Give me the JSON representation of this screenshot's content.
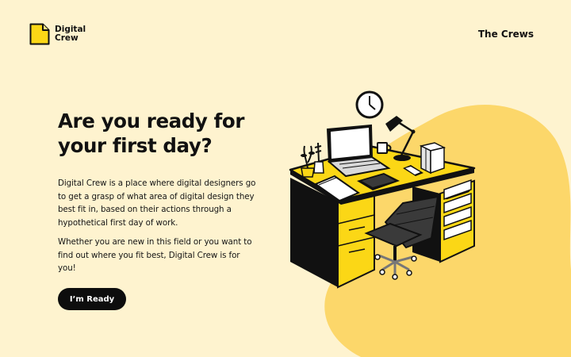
{
  "brand": {
    "name_line1": "Digital",
    "name_line2": "Crew"
  },
  "nav": {
    "crews_link": "The Crews"
  },
  "hero": {
    "title": "Are you ready for your first day?",
    "paragraph_1": "Digital Crew is a place where digital designers go to get a grasp of what area of digital design they best fit in, based on their actions through a hypothetical first day of work.",
    "paragraph_2": "Whether you are new in this field or you want to find out where you fit best, Digital Crew is for you!",
    "cta_label": "I’m Ready"
  },
  "colors": {
    "background": "#fef3cf",
    "blob": "#fcd76a",
    "accent_yellow": "#fbd716",
    "ink": "#111111",
    "cta_background": "#0d0d0d",
    "cta_text": "#ffffff"
  },
  "icons": {
    "logo": "folded-page-logo-icon",
    "illustration": "office-desk-illustration"
  }
}
